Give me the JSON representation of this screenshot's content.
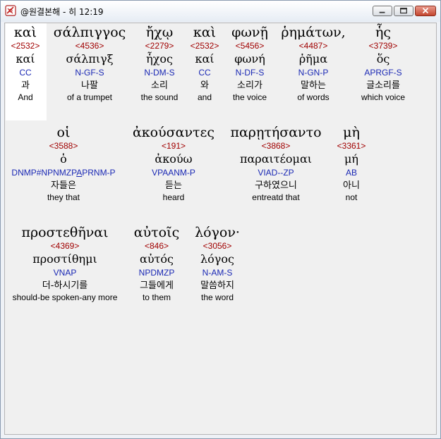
{
  "window": {
    "title": "@원결본해 - 히 12:19",
    "app_icon": "interlinear-app-icon",
    "controls": [
      "minimize-icon",
      "maximize-icon",
      "close-icon"
    ]
  },
  "rows": [
    {
      "words": [
        {
          "greek": "καὶ",
          "strong": "<2532>",
          "lemma": "καί",
          "morph": "CC",
          "korean": "과",
          "english": "And"
        },
        {
          "greek": "σάλπιγγος",
          "strong": "<4536>",
          "lemma": "σάλπιγξ",
          "morph": "N-GF-S",
          "korean": "나팔",
          "english": "of a trumpet"
        },
        {
          "greek": "ἤχῳ",
          "strong": "<2279>",
          "lemma": "ἦχος",
          "morph": "N-DM-S",
          "korean": "소리",
          "english": "the sound"
        },
        {
          "greek": "καὶ",
          "strong": "<2532>",
          "lemma": "καί",
          "morph": "CC",
          "korean": "와",
          "english": "and"
        },
        {
          "greek": "φωνῇ",
          "strong": "<5456>",
          "lemma": "φωνή",
          "morph": "N-DF-S",
          "korean": "소리가",
          "english": "the voice"
        },
        {
          "greek": "ῥημάτων,",
          "strong": "<4487>",
          "lemma": "ῥῆμα",
          "morph": "N-GN-P",
          "korean": "말하는",
          "english": "of words"
        },
        {
          "greek": "ἧς",
          "strong": "<3739>",
          "lemma": "ὅς",
          "morph": "APRGF-S",
          "korean": "글소리를",
          "english": "which voice"
        }
      ]
    },
    {
      "words": [
        {
          "greek": "οἱ",
          "strong": "<3588>",
          "lemma": "ὁ",
          "morph": "DNMP#NPNMZPAPRNM-P",
          "korean": "자들은",
          "english": "they that"
        },
        {
          "greek": "ἀκούσαντες",
          "strong": "<191>",
          "lemma": "ἀκούω",
          "morph": "VPAANM-P",
          "korean": "듣는",
          "english": "heard"
        },
        {
          "greek": "παρῃτήσαντο",
          "strong": "<3868>",
          "lemma": "παραιτέομαι",
          "morph": "VIAD--ZP",
          "korean": "구하였으니",
          "english": "entreatd that"
        },
        {
          "greek": "μὴ",
          "strong": "<3361>",
          "lemma": "μή",
          "morph": "AB",
          "korean": "아니",
          "english": "not"
        }
      ]
    },
    {
      "words": [
        {
          "greek": "προστεθῆναι",
          "strong": "<4369>",
          "lemma": "προστίθημι",
          "morph": "VNAP",
          "korean": "더-하시기를",
          "english": "should-be spoken-any more"
        },
        {
          "greek": "αὐτοῖς",
          "strong": "<846>",
          "lemma": "αὐτός",
          "morph": "NPDMZP",
          "korean": "그들에게",
          "english": "to them"
        },
        {
          "greek": "λόγον·",
          "strong": "<3056>",
          "lemma": "λόγος",
          "morph": "N-AM-S",
          "korean": "말씀하지",
          "english": "the word"
        }
      ]
    }
  ]
}
